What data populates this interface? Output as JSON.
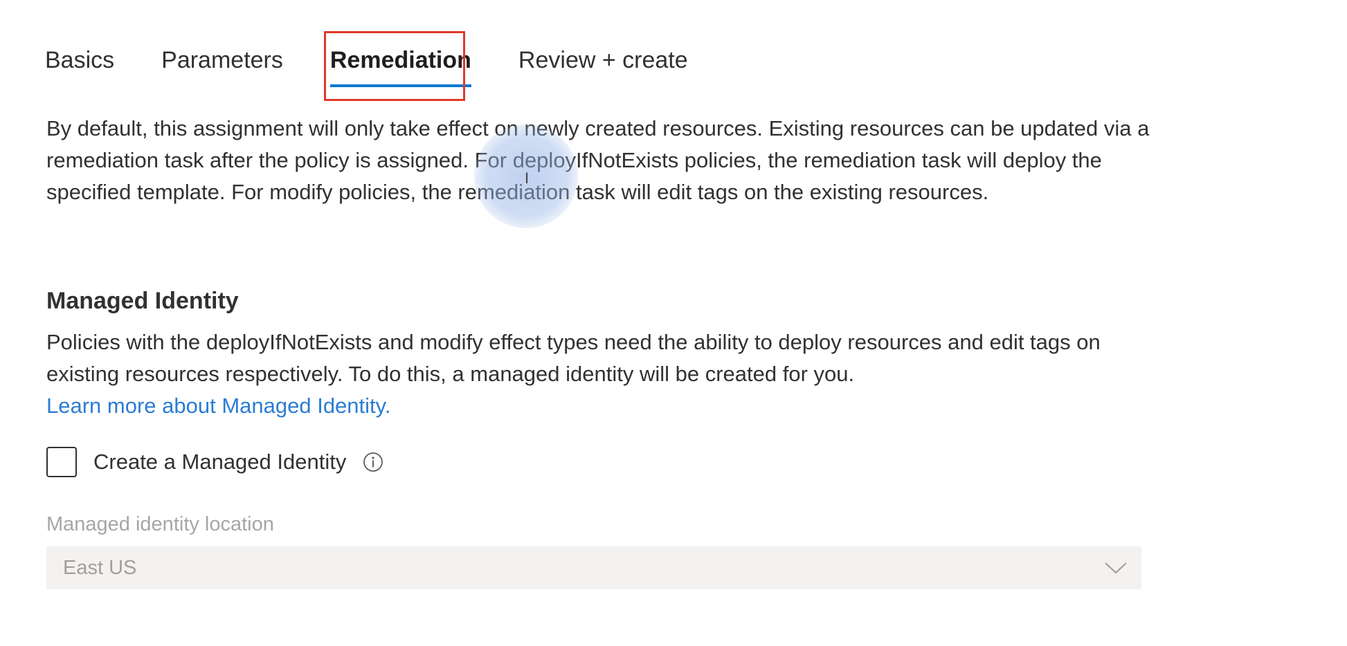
{
  "tabs": [
    {
      "label": "Basics",
      "active": false
    },
    {
      "label": "Parameters",
      "active": false
    },
    {
      "label": "Remediation",
      "active": true
    },
    {
      "label": "Review + create",
      "active": false
    }
  ],
  "intro": {
    "text": "By default, this assignment will only take effect on newly created resources. Existing resources can be updated via a remediation task after the policy is assigned. For deployIfNotExists policies, the remediation task will deploy the specified template. For modify policies, the remediation task will edit tags on the existing resources."
  },
  "managed_identity": {
    "title": "Managed Identity",
    "description": "Policies with the deployIfNotExists and modify effect types need the ability to deploy resources and edit tags on existing resources respectively. To do this, a managed identity will be created for you.",
    "learn_more": "Learn more about Managed Identity.",
    "checkbox_label": "Create a Managed Identity",
    "checkbox_checked": false,
    "location_label": "Managed identity location",
    "location_value": "East US"
  },
  "colors": {
    "accent": "#0078d4",
    "link": "#2b7cd3",
    "highlight_border": "#e0392b",
    "disabled_text": "#a19f9d"
  },
  "icons": {
    "info": "info-icon",
    "dropdown": "chevron-down-icon"
  }
}
